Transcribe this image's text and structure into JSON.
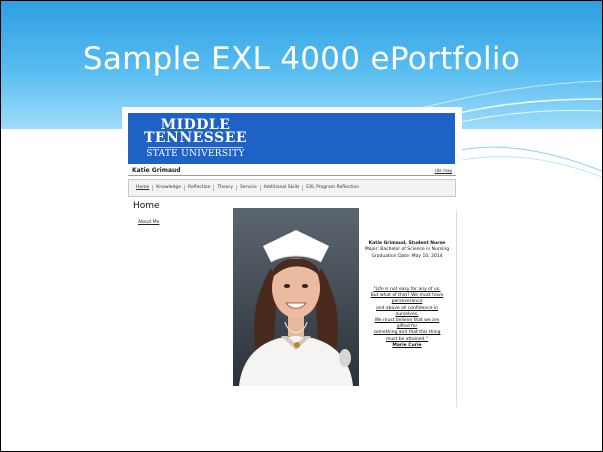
{
  "slide": {
    "title": "Sample EXL 4000 ePortfolio"
  },
  "site": {
    "logo": {
      "line1": "MIDDLE",
      "line2": "TENNESSEE",
      "line3": "STATE UNIVERSITY"
    },
    "owner_name": "Katie Grimaud",
    "site_map": "site map",
    "nav": [
      "Home",
      "Knowledge",
      "Reflection",
      "Theory",
      "Service",
      "Additional Skills",
      "EXL Program Reflection"
    ],
    "page_title": "Home",
    "sidebar_link": "About Me",
    "profile": {
      "title": "Katie Grimaud, Student Nurse",
      "major": "Major: Bachelor of Science in Nursing",
      "graduation": "Graduation Date: May 10, 2014"
    },
    "quote": {
      "lines": [
        "\"Life is not easy for any of us.",
        "But what of that? We must have",
        "perseverance",
        "and above all confidence in",
        "ourselves.",
        "We must believe that we are",
        "gifted for",
        "something and that this thing",
        "must be attained.\""
      ],
      "author": "Marie Curie"
    }
  },
  "colors": {
    "banner": "#2f9fe0",
    "logo_bg": "#1e62c6"
  }
}
